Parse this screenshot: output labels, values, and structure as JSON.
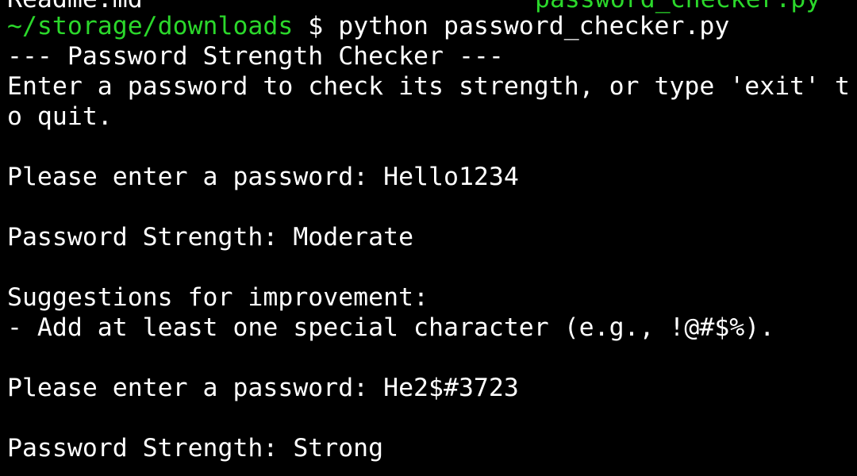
{
  "terminal": {
    "previous_listing": {
      "left_file": "Readme.md",
      "right_file": "password_checker.py"
    },
    "prompt": {
      "path": "~/storage/downloads",
      "symbol": "$",
      "command": "python password_checker.py"
    },
    "output": {
      "header": "--- Password Strength Checker ---",
      "instructions_line1": "Enter a password to check its strength, or type 'exit' t",
      "instructions_line2": "o quit.",
      "entry1": "Please enter a password: Hello1234",
      "strength1": "Password Strength: Moderate",
      "suggestions_header": "Suggestions for improvement:",
      "suggestion1": "- Add at least one special character (e.g., !@#$%).",
      "entry2": "Please enter a password: He2$#3723",
      "strength2": "Password Strength: Strong"
    }
  }
}
